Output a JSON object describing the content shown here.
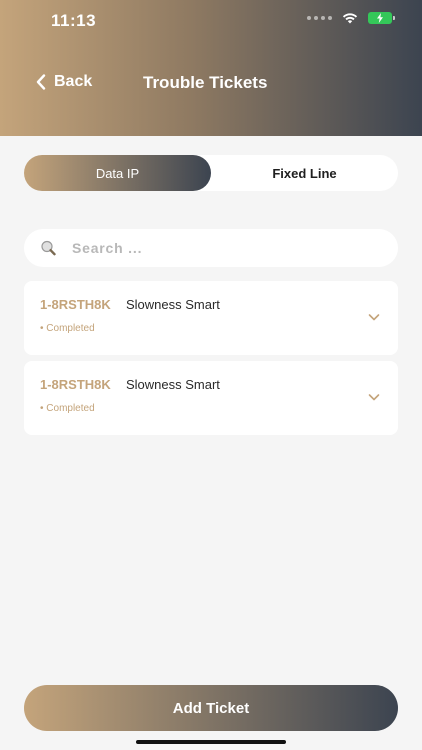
{
  "status_bar": {
    "time": "11:13"
  },
  "nav": {
    "back_label": "Back",
    "title": "Trouble Tickets"
  },
  "tabs": [
    {
      "label": "Data IP",
      "active": true
    },
    {
      "label": "Fixed Line",
      "active": false
    }
  ],
  "search": {
    "placeholder": "Search ...",
    "value": ""
  },
  "tickets": [
    {
      "id": "1-8RSTH8K",
      "title": "Slowness Smart",
      "status": "• Completed"
    },
    {
      "id": "1-8RSTH8K",
      "title": "Slowness Smart",
      "status": "• Completed"
    }
  ],
  "footer": {
    "add_label": "Add Ticket"
  },
  "colors": {
    "accent": "#c4a47b",
    "dark": "#3c4450",
    "background": "#f5f5f5"
  }
}
